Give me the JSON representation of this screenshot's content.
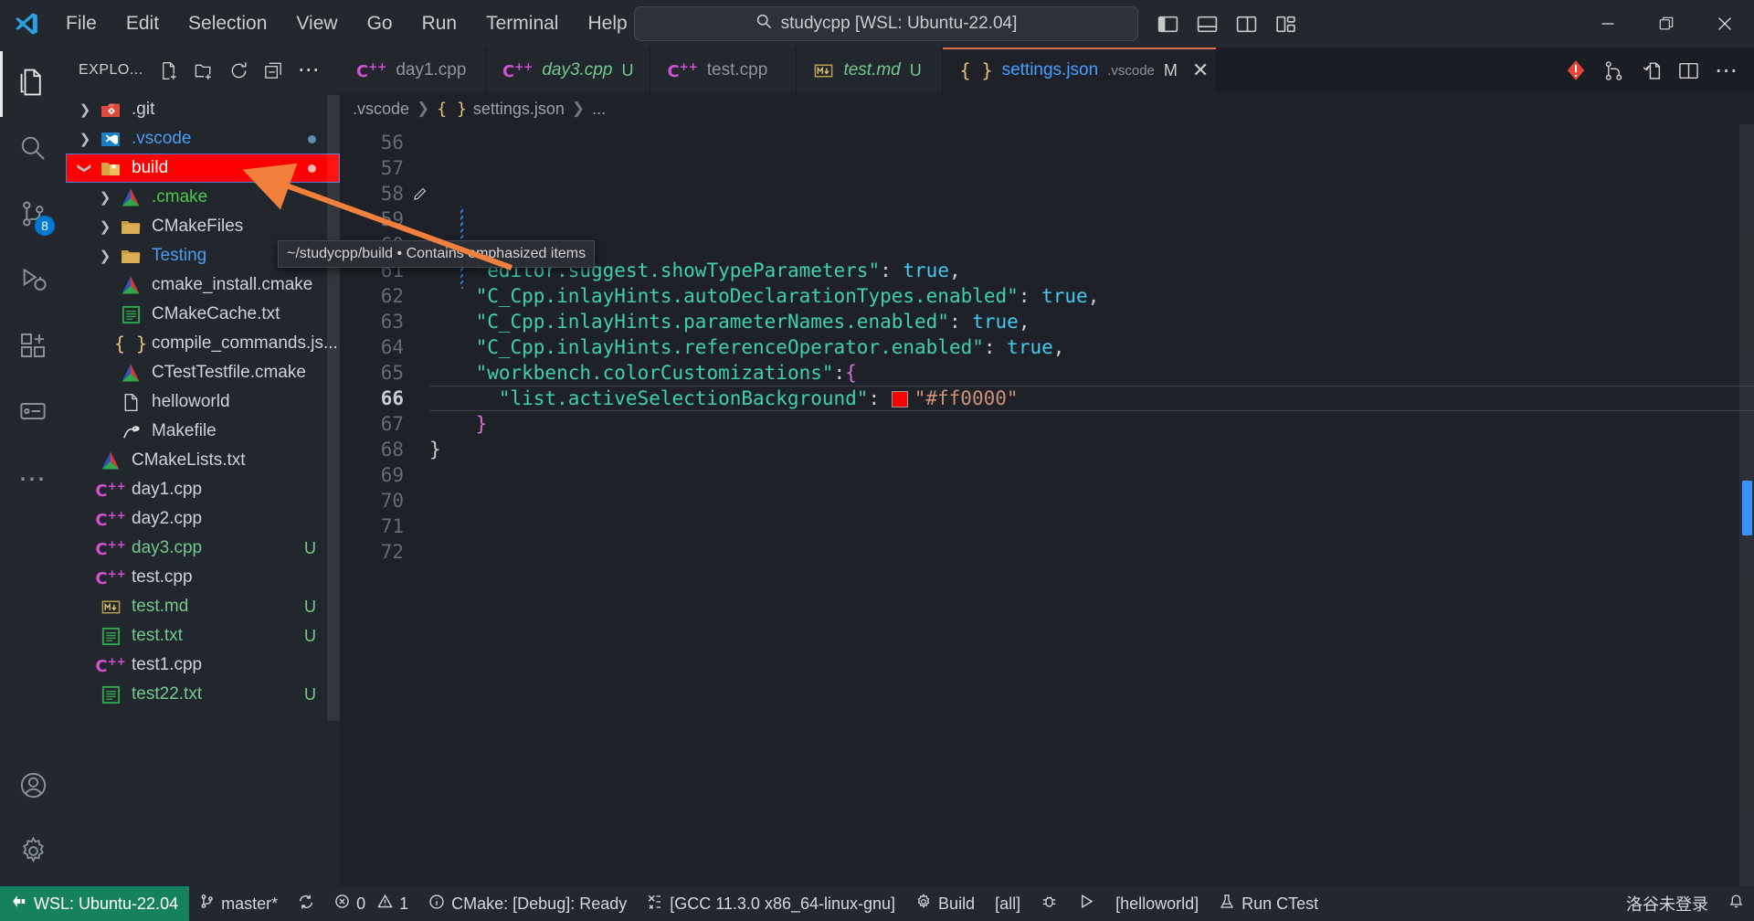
{
  "titlebar": {
    "logo_icon": "vscode-logo-icon",
    "menus": [
      "File",
      "Edit",
      "Selection",
      "View",
      "Go",
      "Run",
      "Terminal",
      "Help"
    ],
    "nav_back_icon": "arrow-left-icon",
    "nav_forward_icon": "arrow-right-icon",
    "command_center": {
      "icon": "search-icon",
      "text": "studycpp [WSL: Ubuntu-22.04]"
    },
    "layout_icons": [
      "toggle-primary-sidebar-icon",
      "toggle-panel-icon",
      "toggle-secondary-sidebar-icon",
      "customize-layout-icon"
    ],
    "window_controls": {
      "minimize": "minimize-icon",
      "restore": "restore-icon",
      "close": "close-icon"
    }
  },
  "activitybar": {
    "items": [
      {
        "name": "explorer",
        "icon": "files-icon",
        "active": true,
        "badge": ""
      },
      {
        "name": "search",
        "icon": "search-icon",
        "active": false,
        "badge": ""
      },
      {
        "name": "source-control",
        "icon": "source-control-icon",
        "active": false,
        "badge": "8"
      },
      {
        "name": "run-and-debug",
        "icon": "run-debug-icon",
        "active": false,
        "badge": ""
      },
      {
        "name": "extensions",
        "icon": "extensions-icon",
        "active": false,
        "badge": ""
      },
      {
        "name": "remote-explorer",
        "icon": "remote-explorer-icon",
        "active": false,
        "badge": ""
      },
      {
        "name": "more-views",
        "icon": "ellipsis-icon",
        "active": false,
        "badge": ""
      }
    ],
    "bottom_items": [
      {
        "name": "accounts",
        "icon": "account-icon"
      },
      {
        "name": "manage",
        "icon": "gear-icon"
      }
    ]
  },
  "sidebar": {
    "title": "EXPLO...",
    "actions": [
      "new-file-icon",
      "new-folder-icon",
      "refresh-icon",
      "collapse-all-icon",
      "views-and-more-icon"
    ],
    "tree": [
      {
        "label": ".git",
        "icon": "git-folder-icon",
        "type": "folder",
        "indent": 0,
        "twisty": "collapsed",
        "badge": "",
        "dot": false,
        "color": "#cfd2d6"
      },
      {
        "label": ".vscode",
        "icon": "vscode-folder-icon",
        "type": "folder",
        "indent": 0,
        "twisty": "collapsed",
        "badge": "",
        "dot": true,
        "color": "#4b9ef0"
      },
      {
        "label": "build",
        "icon": "build-folder-icon",
        "type": "folder",
        "indent": 0,
        "twisty": "expanded",
        "badge": "",
        "dot": true,
        "color": "#ffffff",
        "selected": true
      },
      {
        "label": ".cmake",
        "icon": "cmake-icon",
        "type": "folder",
        "indent": 1,
        "twisty": "collapsed",
        "badge": "",
        "dot": false,
        "color": "#4ec94e"
      },
      {
        "label": "CMakeFiles",
        "icon": "folder-icon",
        "type": "folder",
        "indent": 1,
        "twisty": "collapsed",
        "badge": "",
        "dot": false,
        "color": "#cfd2d6"
      },
      {
        "label": "Testing",
        "icon": "folder-icon",
        "type": "folder",
        "indent": 1,
        "twisty": "collapsed",
        "badge": "",
        "dot": true,
        "color": "#4b9ef0"
      },
      {
        "label": "cmake_install.cmake",
        "icon": "cmake-icon",
        "type": "file",
        "indent": 1,
        "twisty": "none",
        "badge": "",
        "dot": false,
        "color": "#cfd2d6"
      },
      {
        "label": "CMakeCache.txt",
        "icon": "text-icon",
        "type": "file",
        "indent": 1,
        "twisty": "none",
        "badge": "",
        "dot": false,
        "color": "#cfd2d6"
      },
      {
        "label": "compile_commands.js...",
        "icon": "json-icon",
        "type": "file",
        "indent": 1,
        "twisty": "none",
        "badge": "",
        "dot": false,
        "color": "#cfd2d6"
      },
      {
        "label": "CTestTestfile.cmake",
        "icon": "cmake-icon",
        "type": "file",
        "indent": 1,
        "twisty": "none",
        "badge": "",
        "dot": false,
        "color": "#cfd2d6"
      },
      {
        "label": "helloworld",
        "icon": "file-icon",
        "type": "file",
        "indent": 1,
        "twisty": "none",
        "badge": "",
        "dot": false,
        "color": "#cfd2d6"
      },
      {
        "label": "Makefile",
        "icon": "makefile-icon",
        "type": "file",
        "indent": 1,
        "twisty": "none",
        "badge": "",
        "dot": false,
        "color": "#cfd2d6"
      },
      {
        "label": "CMakeLists.txt",
        "icon": "cmake-icon",
        "type": "file",
        "indent": 0,
        "twisty": "none",
        "badge": "",
        "dot": false,
        "color": "#cfd2d6"
      },
      {
        "label": "day1.cpp",
        "icon": "cpp-icon",
        "type": "file",
        "indent": 0,
        "twisty": "none",
        "badge": "",
        "dot": false,
        "color": "#cfd2d6"
      },
      {
        "label": "day2.cpp",
        "icon": "cpp-icon",
        "type": "file",
        "indent": 0,
        "twisty": "none",
        "badge": "",
        "dot": false,
        "color": "#cfd2d6"
      },
      {
        "label": "day3.cpp",
        "icon": "cpp-icon",
        "type": "file",
        "indent": 0,
        "twisty": "none",
        "badge": "U",
        "dot": false,
        "color": "#73c991"
      },
      {
        "label": "test.cpp",
        "icon": "cpp-icon",
        "type": "file",
        "indent": 0,
        "twisty": "none",
        "badge": "",
        "dot": false,
        "color": "#cfd2d6"
      },
      {
        "label": "test.md",
        "icon": "markdown-icon",
        "type": "file",
        "indent": 0,
        "twisty": "none",
        "badge": "U",
        "dot": false,
        "color": "#73c991"
      },
      {
        "label": "test.txt",
        "icon": "text-icon",
        "type": "file",
        "indent": 0,
        "twisty": "none",
        "badge": "U",
        "dot": false,
        "color": "#73c991"
      },
      {
        "label": "test1.cpp",
        "icon": "cpp-icon",
        "type": "file",
        "indent": 0,
        "twisty": "none",
        "badge": "",
        "dot": false,
        "color": "#cfd2d6"
      },
      {
        "label": "test22.txt",
        "icon": "text-icon",
        "type": "file",
        "indent": 0,
        "twisty": "none",
        "badge": "U",
        "dot": false,
        "color": "#73c991"
      }
    ],
    "tooltip": "~/studycpp/build  •  Contains emphasized items"
  },
  "editor": {
    "tabs": [
      {
        "icon": "cpp-icon",
        "name": "day1.cpp",
        "desc": "",
        "badge": "",
        "dirty": false,
        "active": false
      },
      {
        "icon": "cpp-icon",
        "name": "day3.cpp",
        "desc": "",
        "badge": "U",
        "dirty": true,
        "active": false
      },
      {
        "icon": "cpp-icon",
        "name": "test.cpp",
        "desc": "",
        "badge": "",
        "dirty": false,
        "active": false
      },
      {
        "icon": "markdown-icon",
        "name": "test.md",
        "desc": "",
        "badge": "U",
        "dirty": true,
        "active": false
      },
      {
        "icon": "json-icon",
        "name": "settings.json",
        "desc": ".vscode",
        "badge": "M",
        "dirty": false,
        "active": true
      }
    ],
    "tab_actions": [
      "run-code-icon",
      "split-terminal-icon",
      "open-changes-icon",
      "split-editor-icon",
      "more-actions-icon"
    ],
    "breadcrumb": [
      ".vscode",
      "settings.json",
      "..."
    ],
    "breadcrumb_json_icon": "json-icon",
    "cursor_line": 66,
    "lines": [
      {
        "no": 56,
        "fold": "",
        "segments": [
          {
            "t": "    ",
            "c": "p"
          },
          {
            "t": "\"editor.suggest.showTypeParameters\"",
            "c": "k"
          },
          {
            "t": ": ",
            "c": "p"
          },
          {
            "t": "true",
            "c": "b"
          },
          {
            "t": ",",
            "c": "p"
          }
        ]
      },
      {
        "no": 57,
        "fold": "",
        "segments": [
          {
            "t": "    ",
            "c": "p"
          },
          {
            "t": "\"C_Cpp.inlayHints.autoDeclarationTypes.enabled\"",
            "c": "k"
          },
          {
            "t": ": ",
            "c": "p"
          },
          {
            "t": "true",
            "c": "b"
          },
          {
            "t": ",",
            "c": "p"
          }
        ]
      },
      {
        "no": 58,
        "fold": "pencil",
        "segments": [
          {
            "t": "    ",
            "c": "p"
          },
          {
            "t": "\"C_Cpp.inlayHints.parameterNames.enabled\"",
            "c": "k"
          },
          {
            "t": ": ",
            "c": "p"
          },
          {
            "t": "true",
            "c": "b"
          },
          {
            "t": ",",
            "c": "p"
          }
        ]
      },
      {
        "no": 59,
        "fold": "",
        "segments": [
          {
            "t": "    ",
            "c": "p"
          },
          {
            "t": "\"C_Cpp.inlayHints.referenceOperator.enabled\"",
            "c": "k"
          },
          {
            "t": ": ",
            "c": "p"
          },
          {
            "t": "true",
            "c": "b"
          },
          {
            "t": ",",
            "c": "p"
          }
        ]
      },
      {
        "no": 60,
        "fold": "",
        "segments": [
          {
            "t": "    ",
            "c": "p"
          },
          {
            "t": "\"workbench.colorCustomizations\"",
            "c": "k"
          },
          {
            "t": ":",
            "c": "p"
          },
          {
            "t": "{",
            "c": "br"
          }
        ]
      },
      {
        "no": 61,
        "fold": "",
        "segments": [
          {
            "t": "      ",
            "c": "p"
          },
          {
            "t": "\"list.activeSelectionBackground\"",
            "c": "k"
          },
          {
            "t": ": ",
            "c": "p"
          },
          {
            "t": "@SWATCH@",
            "c": "swatch"
          },
          {
            "t": "\"#ff0000\"",
            "c": "s"
          }
        ]
      },
      {
        "no": 62,
        "fold": "",
        "segments": [
          {
            "t": "    ",
            "c": "p"
          },
          {
            "t": "}",
            "c": "br"
          }
        ]
      },
      {
        "no": 63,
        "fold": "",
        "segments": [
          {
            "t": "}",
            "c": "p"
          }
        ]
      },
      {
        "no": 64,
        "fold": "",
        "segments": []
      },
      {
        "no": 65,
        "fold": "",
        "segments": []
      },
      {
        "no": 66,
        "fold": "",
        "segments": []
      },
      {
        "no": 67,
        "fold": "",
        "segments": []
      },
      {
        "no": 68,
        "fold": "",
        "segments": []
      },
      {
        "no": 69,
        "fold": "",
        "segments": []
      },
      {
        "no": 70,
        "fold": "",
        "segments": []
      },
      {
        "no": 71,
        "fold": "",
        "segments": []
      },
      {
        "no": 72,
        "fold": "",
        "segments": []
      }
    ]
  },
  "statusbar": {
    "remote": {
      "icon": "remote-icon",
      "label": "WSL: Ubuntu-22.04"
    },
    "items": [
      {
        "icon": "source-control-icon",
        "label": "master*"
      },
      {
        "icon": "sync-icon",
        "label": ""
      },
      {
        "icon": "error-icon",
        "label": "0",
        "icon2": "warning-icon",
        "label2": "1"
      },
      {
        "icon": "info-icon",
        "label": "CMake: [Debug]: Ready"
      },
      {
        "icon": "tools-icon",
        "label": "[GCC 11.3.0 x86_64-linux-gnu]"
      },
      {
        "icon": "gear-icon",
        "label": "Build"
      },
      {
        "icon": "",
        "label": "[all]"
      },
      {
        "icon": "bug-icon",
        "label": ""
      },
      {
        "icon": "play-icon",
        "label": ""
      },
      {
        "icon": "",
        "label": "[helloworld]"
      },
      {
        "icon": "beaker-icon",
        "label": "Run CTest"
      }
    ],
    "right": [
      {
        "icon": "",
        "label": "洛谷未登录"
      },
      {
        "icon": "bell-icon",
        "label": ""
      }
    ]
  },
  "colors": {
    "accent_red": "#ff0000",
    "tab_active_top": "#e06c52",
    "remote_green": "#16825d",
    "badge_blue": "#0078d4",
    "modified_green": "#73c991",
    "arrow_orange": "#f0803c"
  }
}
